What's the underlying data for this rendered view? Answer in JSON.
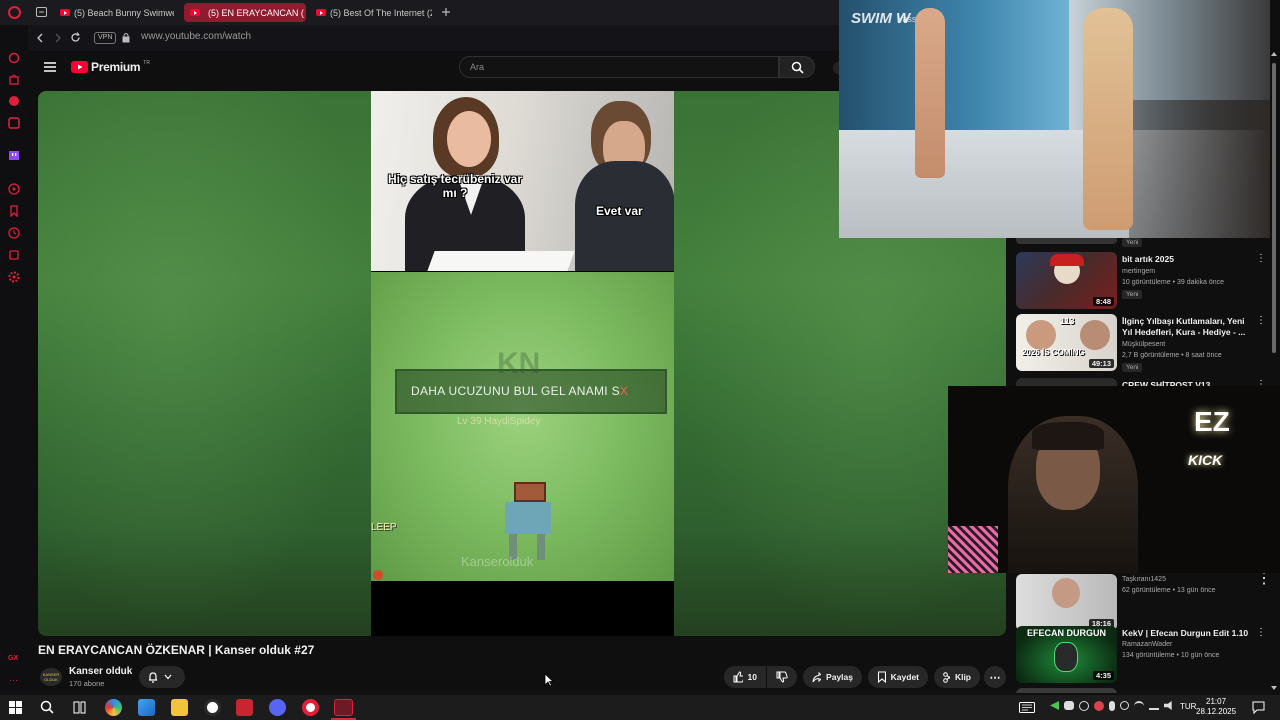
{
  "browser": {
    "tabs": [
      {
        "label": "(5) Beach Bunny Swimwe",
        "active": false
      },
      {
        "label": "(5) EN ERAYCANCAN (",
        "active": true
      },
      {
        "label": "(5) Best Of The Internet (2",
        "active": false
      }
    ],
    "vpn_label": "VPN",
    "url": "www.youtube.com/watch",
    "sidebar_badge": "GX"
  },
  "youtube": {
    "logo_text": "Premium",
    "logo_superscript": "TR",
    "search_placeholder": "Ara"
  },
  "video_content": {
    "meme_question": "Hiç satış tecrübeniz var mı ?",
    "meme_answer": "Evet var",
    "game_chat": "DAHA UCUZUNU BUL GEL ANAMI S",
    "game_chat_end": "X",
    "player_nametag": "Lv 39 HaydiSpidey",
    "watermark": "Kanserolduk",
    "side_text": "LEEP"
  },
  "video": {
    "title": "EN ERAYCANCAN ÖZKENAR | Kanser olduk #27",
    "channel": {
      "name": "Kanser olduk",
      "subscribers": "170 abone",
      "avatar_text": "KANSER OLDUK"
    },
    "actions": {
      "likes": "10",
      "share": "Paylaş",
      "save": "Kaydet",
      "clip": "Klip"
    }
  },
  "recommendations": [
    {
      "title": "bit artık 2025",
      "channel": "mertingem",
      "meta": "10 görüntüleme • 39 dakika önce",
      "badge": "Yeni",
      "duration": "8:48"
    },
    {
      "title": "İlginç Yılbaşı Kutlamaları, Yeni Yıl Hedefleri, Kura - Hediye - ...",
      "channel": "Müşkülpesent",
      "meta": "2,7 B görüntüleme • 8 saat önce",
      "badge": "Yeni",
      "duration": "49:13",
      "thumb_text": "2026 İS COMİNG",
      "thumb_number": "113"
    },
    {
      "title": "CREW SHİTPOST V13",
      "channel": "",
      "meta": "",
      "badge": "",
      "duration": ""
    },
    {
      "title": "",
      "channel": "Taşkıranı1425",
      "meta": "62 görüntüleme • 13 gün önce",
      "badge": "",
      "duration": "18:16"
    },
    {
      "title": "KekV | Efecan Durgun Edit 1.10",
      "channel": "RamazanWader",
      "meta": "134 görüntüleme • 10 gün önce",
      "badge": "",
      "duration": "4:35",
      "thumb_text": "EFECAN DURGUN"
    },
    {
      "title": "",
      "channel": "",
      "meta": "",
      "badge": "",
      "duration": ""
    }
  ],
  "first_rec_badge": "Yeni",
  "pip_runway": {
    "watermark": "Yasss.com",
    "sign": "SWIM W"
  },
  "pip_cam": {
    "logo": "EZ",
    "logo_sub": "KICK"
  },
  "taskbar": {
    "language": "TUR",
    "time": "21:07",
    "date": "28.12.2025"
  },
  "colors": {
    "accent": "#ff0033",
    "opera_red": "#e0203a",
    "bg": "#0f0f0f",
    "green_screen": "#43803d"
  }
}
